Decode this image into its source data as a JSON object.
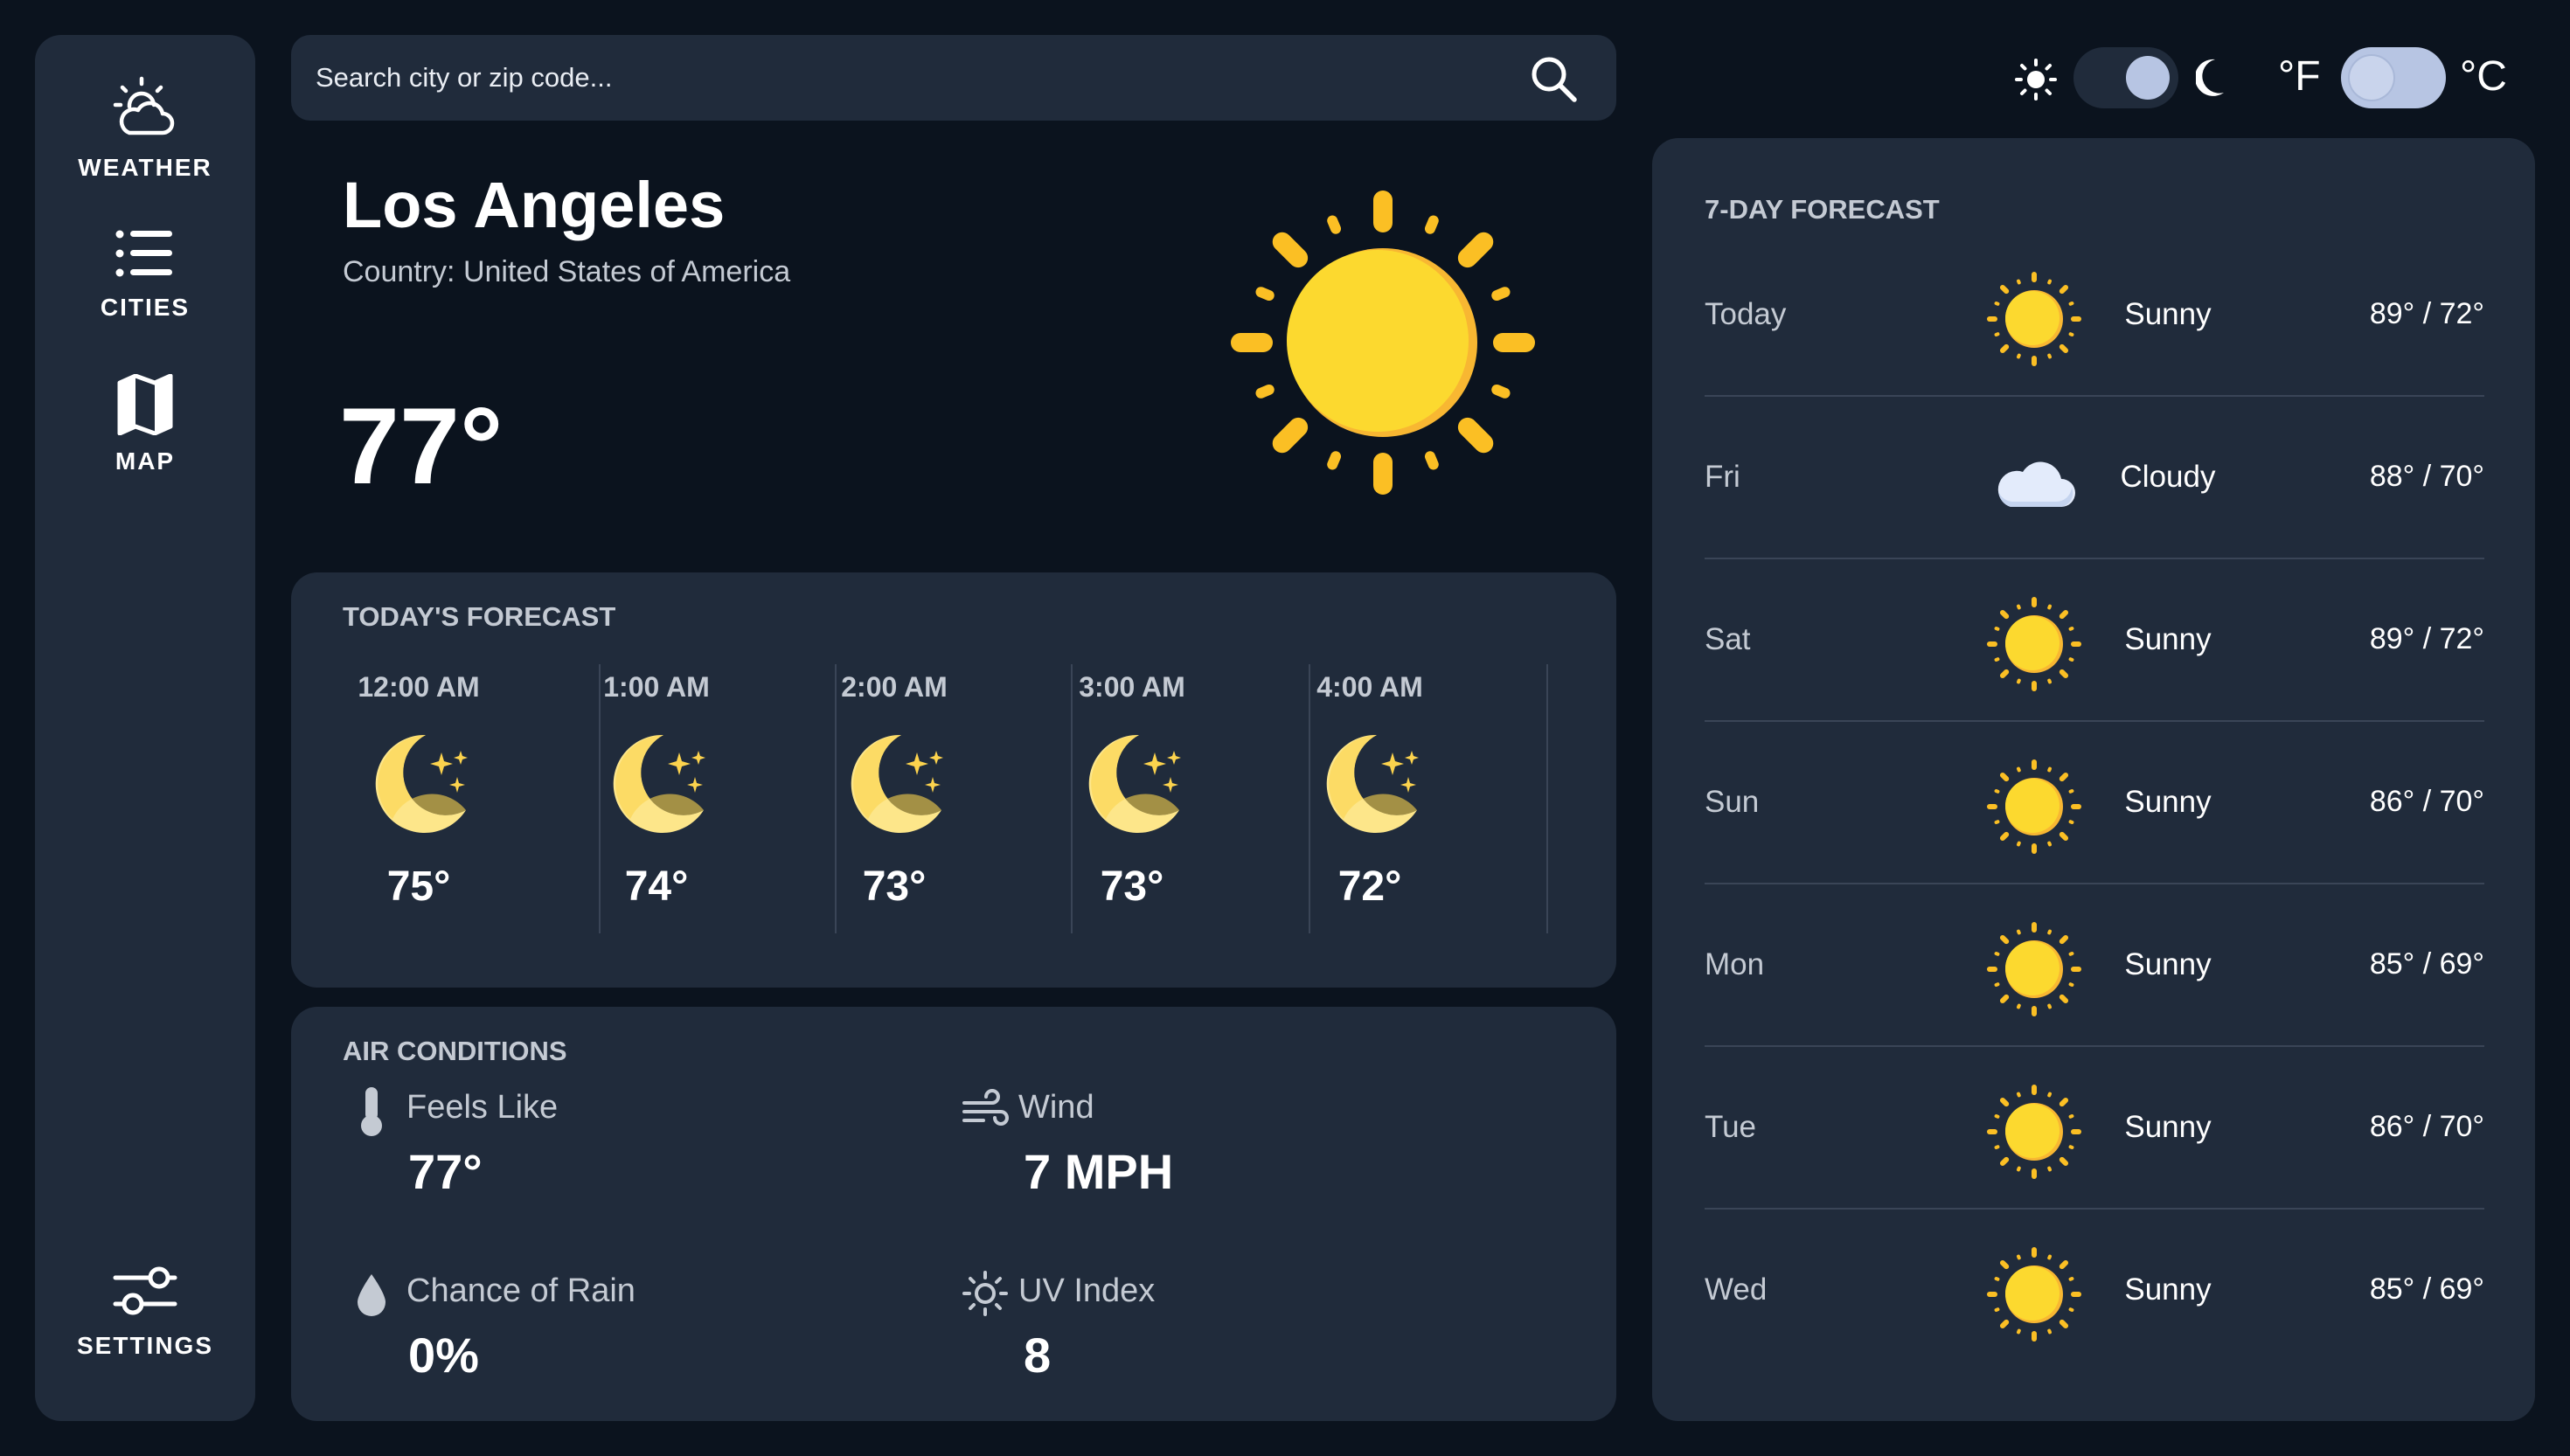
{
  "sidebar": {
    "items": [
      {
        "label": "WEATHER",
        "icon": "cloud-sun-icon"
      },
      {
        "label": "CITIES",
        "icon": "list-icon"
      },
      {
        "label": "MAP",
        "icon": "map-icon"
      },
      {
        "label": "SETTINGS",
        "icon": "sliders-icon"
      }
    ]
  },
  "search": {
    "placeholder": "Search city or zip code...",
    "icon": "search-icon"
  },
  "toggles": {
    "theme": {
      "left_icon": "sun-icon",
      "right_icon": "moon-icon",
      "state": "dark"
    },
    "units": {
      "left_label": "°F",
      "right_label": "°C",
      "state": "fahrenheit"
    }
  },
  "current": {
    "city": "Los Angeles",
    "country": "Country: United States of America",
    "temp": "77°",
    "icon": "sun-icon"
  },
  "today": {
    "title": "TODAY'S FORECAST",
    "hours": [
      {
        "time": "12:00 AM",
        "icon": "moon-stars-icon",
        "temp": "75°"
      },
      {
        "time": "1:00 AM",
        "icon": "moon-stars-icon",
        "temp": "74°"
      },
      {
        "time": "2:00 AM",
        "icon": "moon-stars-icon",
        "temp": "73°"
      },
      {
        "time": "3:00 AM",
        "icon": "moon-stars-icon",
        "temp": "73°"
      },
      {
        "time": "4:00 AM",
        "icon": "moon-stars-icon",
        "temp": "72°"
      }
    ]
  },
  "air": {
    "title": "AIR CONDITIONS",
    "feels_like": {
      "label": "Feels Like",
      "value": "77°",
      "icon": "thermometer-icon"
    },
    "wind": {
      "label": "Wind",
      "value": "7 MPH",
      "icon": "wind-icon"
    },
    "rain": {
      "label": "Chance of Rain",
      "value": "0%",
      "icon": "droplet-icon"
    },
    "uv": {
      "label": "UV Index",
      "value": "8",
      "icon": "uv-sun-icon"
    }
  },
  "week": {
    "title": "7-DAY FORECAST",
    "days": [
      {
        "day": "Today",
        "condition": "Sunny",
        "temps": "89° / 72°",
        "icon": "sun-icon"
      },
      {
        "day": "Fri",
        "condition": "Cloudy",
        "temps": "88° / 70°",
        "icon": "cloud-icon"
      },
      {
        "day": "Sat",
        "condition": "Sunny",
        "temps": "89° / 72°",
        "icon": "sun-icon"
      },
      {
        "day": "Sun",
        "condition": "Sunny",
        "temps": "86° / 70°",
        "icon": "sun-icon"
      },
      {
        "day": "Mon",
        "condition": "Sunny",
        "temps": "85° / 69°",
        "icon": "sun-icon"
      },
      {
        "day": "Tue",
        "condition": "Sunny",
        "temps": "86° / 70°",
        "icon": "sun-icon"
      },
      {
        "day": "Wed",
        "condition": "Sunny",
        "temps": "85° / 69°",
        "icon": "sun-icon"
      }
    ]
  },
  "colors": {
    "background": "#0b131e",
    "panel": "#202b3b",
    "muted_text": "#c4cad3",
    "sun_yellow": "#fcd92f",
    "sun_ray": "#fbbf24",
    "moon": "#fde68a",
    "toggle_active": "#b7c5e3"
  }
}
